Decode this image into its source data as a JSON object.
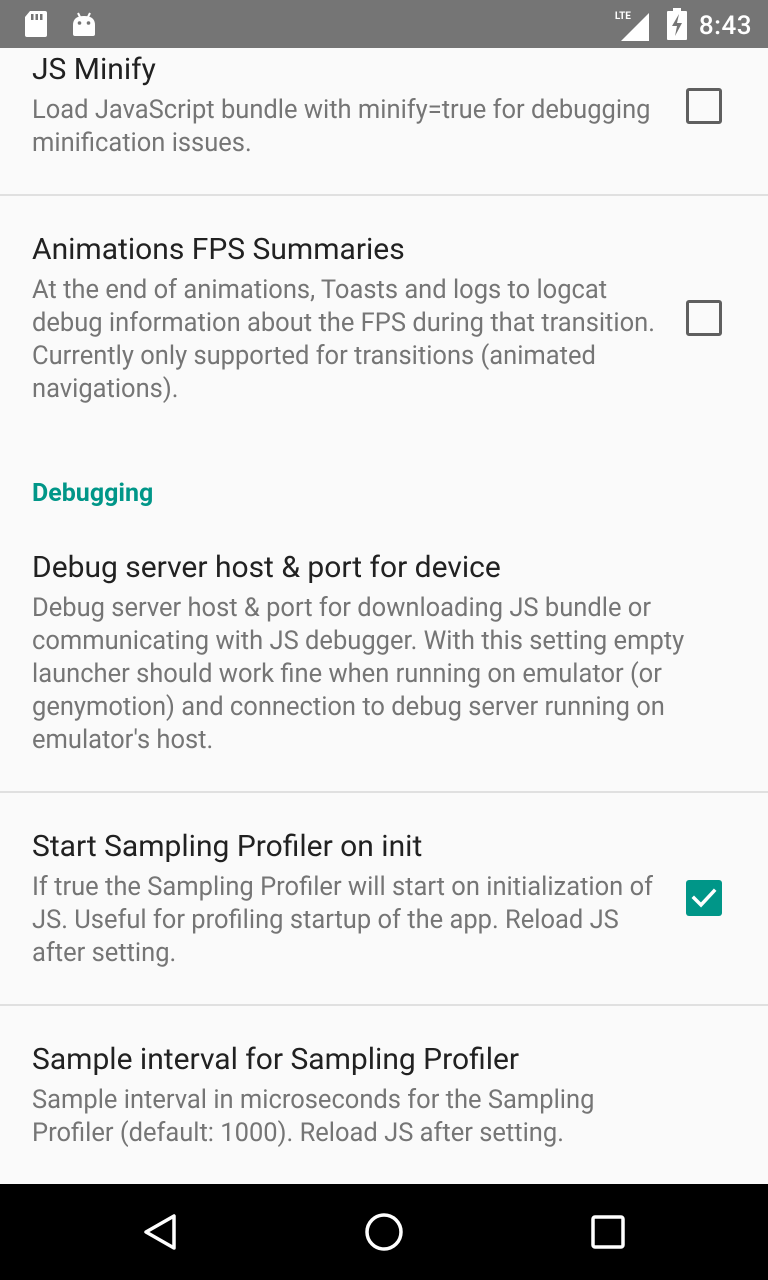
{
  "status_bar": {
    "time": "8:43",
    "network_label": "LTE",
    "icons": [
      "sd-card-icon",
      "android-icon",
      "lte-signal-icon",
      "battery-charging-icon"
    ]
  },
  "settings": {
    "js_minify": {
      "title": "JS Minify",
      "summary": "Load JavaScript bundle with minify=true for debugging minification issues.",
      "checked": false
    },
    "animations_fps": {
      "title": "Animations FPS Summaries",
      "summary": "At the end of animations, Toasts and logs to logcat debug information about the FPS during that transition. Currently only supported for transitions (animated navigations).",
      "checked": false
    },
    "debugging_category": "Debugging",
    "debug_server": {
      "title": "Debug server host & port for device",
      "summary": "Debug server host & port for downloading JS bundle or communicating with JS debugger. With this setting empty launcher should work fine when running on emulator (or genymotion) and connection to debug server running on emulator's host."
    },
    "sampling_profiler": {
      "title": "Start Sampling Profiler on init",
      "summary": "If true the Sampling Profiler will start on initialization of JS. Useful for profiling startup of the app. Reload JS after setting.",
      "checked": true
    },
    "sample_interval": {
      "title": "Sample interval for Sampling Profiler",
      "summary": "Sample interval in microseconds for the Sampling Profiler (default: 1000). Reload JS after setting."
    }
  },
  "colors": {
    "accent": "#009688",
    "status_bar": "#757575",
    "nav_bar": "#000000"
  },
  "nav_bar": {
    "buttons": [
      "back-icon",
      "home-icon",
      "recents-icon"
    ]
  }
}
